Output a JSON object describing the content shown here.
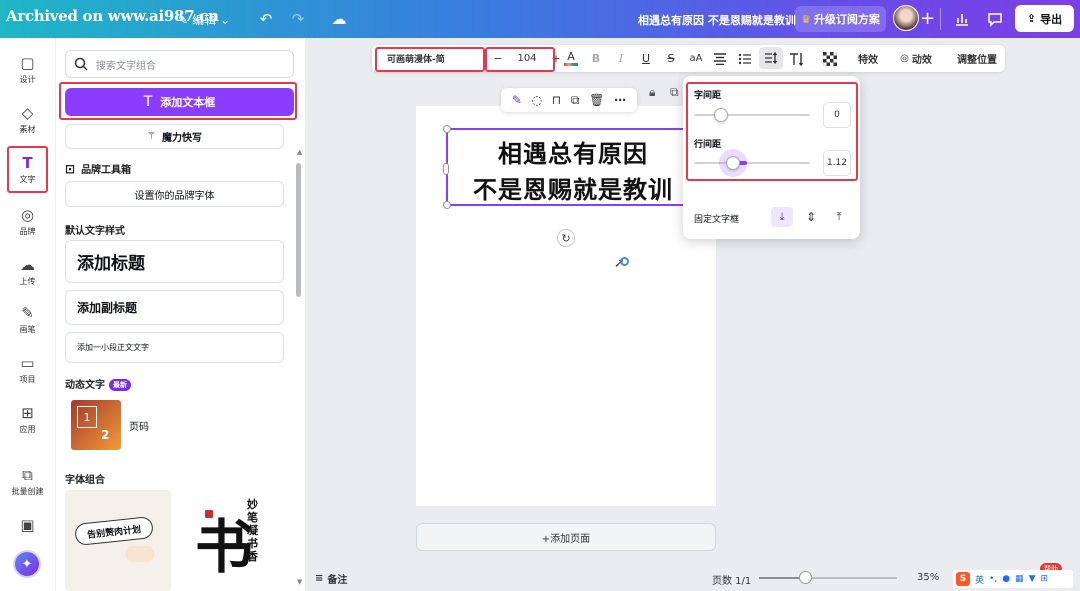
{
  "watermark": "Archived on www.ai987.cn",
  "topbar": {
    "edit_label": "编辑",
    "doc_title": "相遇总有原因 不是恩赐就是教训",
    "upgrade_label": "升级订阅方案",
    "export_label": "导出"
  },
  "rail": [
    {
      "label": "设计",
      "icon": "▢"
    },
    {
      "label": "素材",
      "icon": "◇"
    },
    {
      "label": "文字",
      "icon": "T"
    },
    {
      "label": "品牌",
      "icon": "◎"
    },
    {
      "label": "上传",
      "icon": "☁"
    },
    {
      "label": "画笔",
      "icon": "✎"
    },
    {
      "label": "项目",
      "icon": "▭"
    },
    {
      "label": "应用",
      "icon": "⊞"
    },
    {
      "label": "批量创建",
      "icon": "⧉"
    }
  ],
  "panel": {
    "search_placeholder": "搜索文字组合",
    "add_textbox": "添加文本框",
    "magic_write": "魔力快写",
    "brand_kit": "品牌工具箱",
    "brand_font_btn": "设置你的品牌字体",
    "default_styles": "默认文字样式",
    "add_heading": "添加标题",
    "add_subheading": "添加副标题",
    "add_body": "添加一小段正文文字",
    "dynamic_text": "动态文字",
    "new_badge": "最新",
    "page_number": "页码",
    "page_thumb_a": "1",
    "page_thumb_b": "2",
    "font_combos": "字体组合",
    "combo1_text": "告别赘肉计划",
    "combo2_big": "书",
    "combo2_small": "妙笔凝书香"
  },
  "toolbar": {
    "font_name": "可画萌漫体-简",
    "minus": "−",
    "font_size": "104",
    "plus": "+",
    "case": "aA",
    "effects": "特效",
    "animate": "动效",
    "position": "调整位置"
  },
  "canvas": {
    "line1": "相遇总有原因",
    "line2": "不是恩赐就是教训"
  },
  "spacing": {
    "letter_label": "字间距",
    "letter_value": "0",
    "line_label": "行间距",
    "line_value": "1.12",
    "fixed_label": "固定文字框"
  },
  "add_page": "+添加页面",
  "bottom": {
    "notes": "备注",
    "pages": "页数 1/1",
    "zoom": "35%",
    "help": "帮助",
    "ime": "英"
  }
}
